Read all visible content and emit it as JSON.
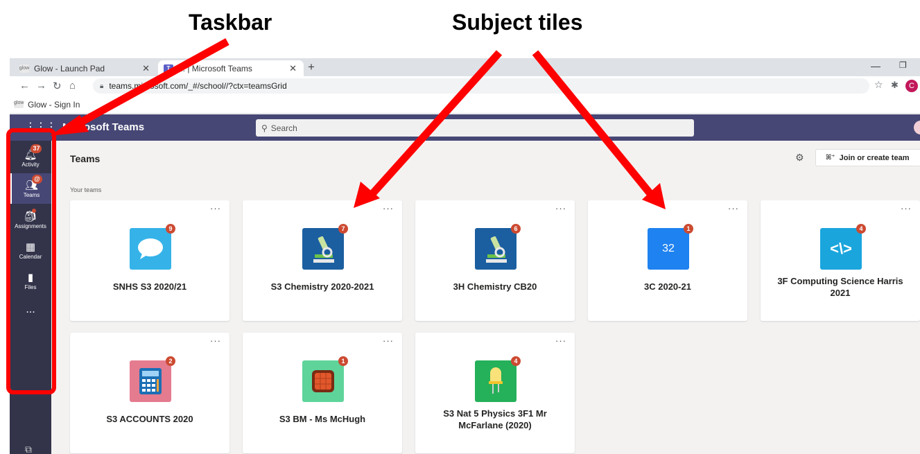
{
  "callouts": {
    "taskbar": "Taskbar",
    "subject_tiles": "Subject tiles"
  },
  "browser": {
    "tabs": [
      {
        "favicon": "glow",
        "title": "Glow - Launch Pad",
        "close": "✕"
      },
      {
        "favicon": "T",
        "title": "... | Microsoft Teams",
        "close": "✕"
      }
    ],
    "new_tab": "+",
    "url": "teams.microsoft.com/_#/school//?ctx=teamsGrid",
    "bookmark": "Glow - Sign In",
    "profile_initial": "C"
  },
  "teams": {
    "app_title": "Microsoft Teams",
    "search_placeholder": "Search",
    "page_title": "Teams",
    "join_button": "Join or create team",
    "section_label": "Your teams",
    "rail": [
      {
        "label": "Activity",
        "icon": "bell-icon",
        "badge": "37"
      },
      {
        "label": "Teams",
        "icon": "teams-icon",
        "badge": "@"
      },
      {
        "label": "Assignments",
        "icon": "backpack-icon",
        "dot": true
      },
      {
        "label": "Calendar",
        "icon": "calendar-icon"
      },
      {
        "label": "Files",
        "icon": "file-icon"
      },
      {
        "label": "...",
        "icon": "more-icon"
      }
    ],
    "team_cards": [
      {
        "name": "SNHS S3 2020/21",
        "badge": "9",
        "icon": "speech-bubble-icon",
        "color": "#35b3e9"
      },
      {
        "name": "S3 Chemistry 2020-2021",
        "badge": "7",
        "icon": "microscope-icon",
        "color": "#1b5fa0"
      },
      {
        "name": "3H Chemistry CB20",
        "badge": "6",
        "icon": "microscope-icon",
        "color": "#1b5fa0"
      },
      {
        "name": "3C 2020-21",
        "badge": "1",
        "avatar_text": "32",
        "color": "#1e82f0"
      },
      {
        "name": "3F Computing Science Harris 2021",
        "badge": "4",
        "icon": "code-icon",
        "color": "#1aa5dd"
      },
      {
        "name": "S3 ACCOUNTS 2020",
        "badge": "2",
        "icon": "calculator-icon",
        "color": "#e57b8f"
      },
      {
        "name": "S3 BM - Ms McHugh",
        "badge": "1",
        "icon": "square-icon",
        "color": "#5ed49b"
      },
      {
        "name": "S3 Nat 5 Physics 3F1 Mr McFarlane (2020)",
        "badge": "4",
        "icon": "led-icon",
        "color": "#25b05a"
      }
    ]
  }
}
